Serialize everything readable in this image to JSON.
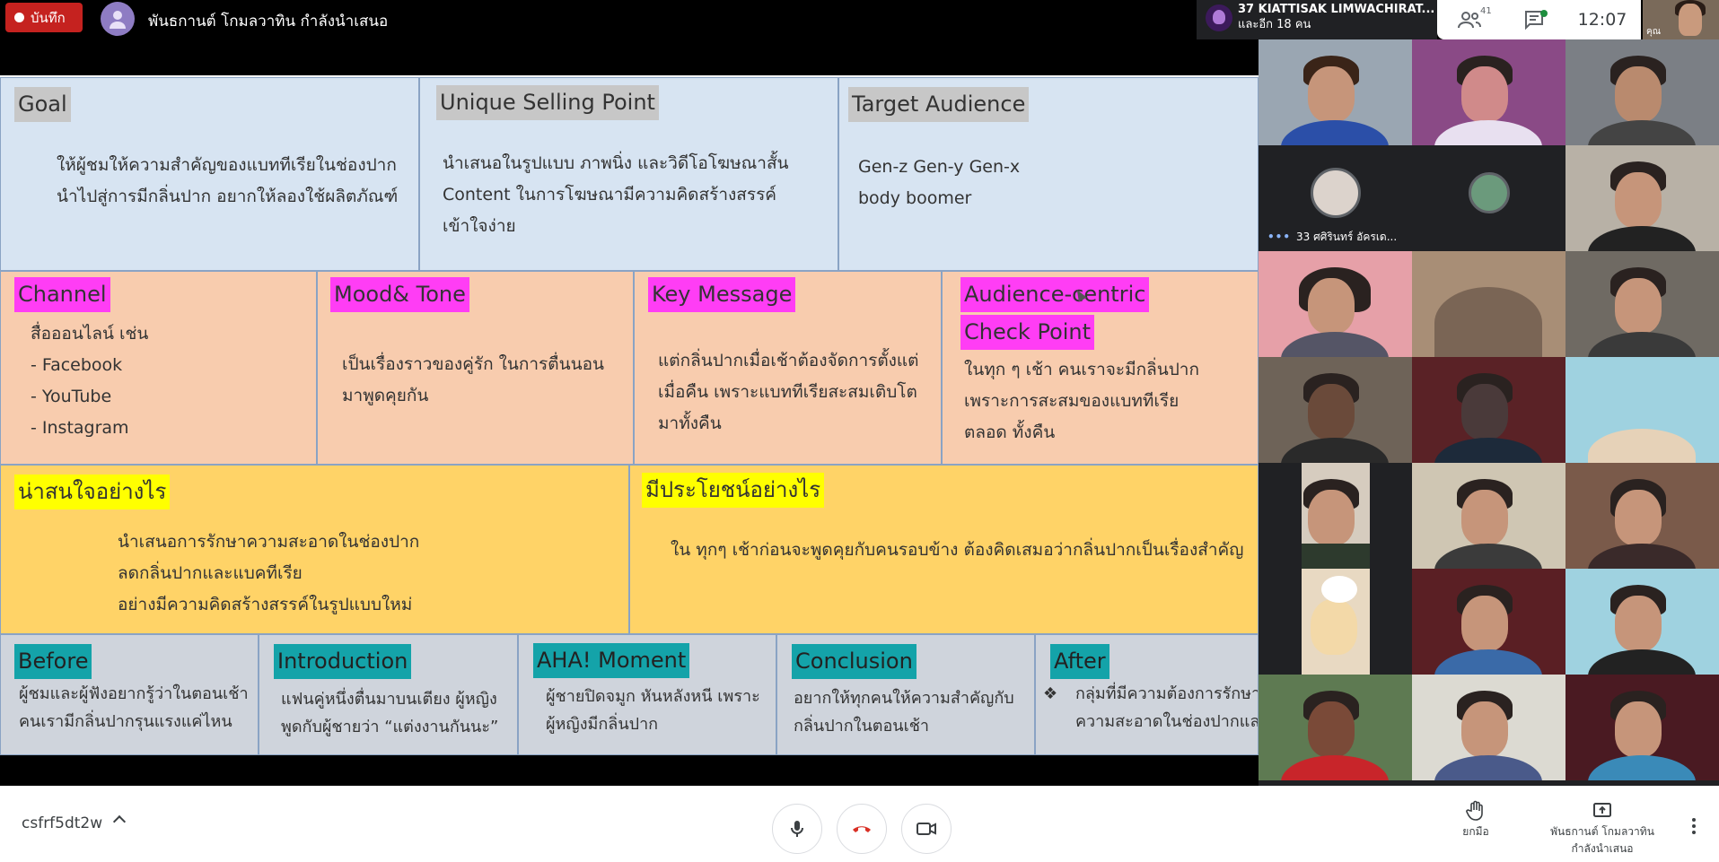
{
  "top_bar": {
    "record_label": "บันทึก",
    "presenter_title": "พันธกานต์ โกมลวาทิน กำลังนำเสนอ",
    "pinned_user_name": "37 KIATTISAK LIMWACHIRAT...",
    "pinned_user_sub": "และอีก 18 คน",
    "participant_count": "41",
    "clock": "12:07",
    "self_label": "คุณ"
  },
  "slide": {
    "goal": {
      "heading": "Goal",
      "lines": [
        "ให้ผู้ชมให้ความสำคัญของแบททีเรียในช่องปาก",
        "นำไปสู่การมีกลิ่นปาก อยากให้ลองใช้ผลิตภัณฑ์"
      ]
    },
    "usp": {
      "heading": "Unique Selling Point",
      "lines": [
        "นำเสนอในรูปแบบ ภาพนิ่ง และวิดีโอโฆษณาสั้น",
        "Content ในการโฆษณามีความคิดสร้างสรรค์",
        "เข้าใจง่าย"
      ]
    },
    "target": {
      "heading": "Target Audience",
      "lines": [
        "Gen-z Gen-y Gen-x",
        "body boomer"
      ]
    },
    "channel": {
      "heading": "Channel",
      "lines": [
        "สื่อออนไลน์ เช่น",
        "- Facebook",
        "- YouTube",
        "- Instagram"
      ]
    },
    "mood": {
      "heading": "Mood& Tone",
      "lines": [
        "เป็นเรื่องราวของคู่รัก ในการตื่นนอน",
        "มาพูดคุยกัน"
      ]
    },
    "key_message": {
      "heading": "Key Message",
      "lines": [
        "แต่กลิ่นปากเมื่อเช้าต้องจัดการตั้งแต่",
        "เมื่อคืน เพราะแบททีเรียสะสมเติบโต",
        "มาทั้งคืน"
      ]
    },
    "audience_centric": {
      "heading_1": "Audience-centric",
      "heading_2": "Check Point",
      "lines": [
        "ในทุก ๆ เช้า คนเราจะมีกลิ่นปาก",
        "เพราะการสะสมของแบททีเรีย",
        "ตลอด ทั้งคืน"
      ]
    },
    "interesting": {
      "heading": "น่าสนใจอย่างไร",
      "lines": [
        "นำเสนอการรักษาความสะอาดในช่องปาก",
        "ลดกลิ่นปากและแบคทีเรีย",
        "อย่างมีความคิดสร้างสรรค์ในรูปแบบใหม่"
      ]
    },
    "benefit": {
      "heading": "มีประโยชน์อย่างไร",
      "lines": [
        "ใน ทุกๆ เช้าก่อนจะพูดคุยกับคนรอบข้าง ต้องคิดเสมอว่ากลิ่นปากเป็นเรื่องสำคัญ"
      ]
    },
    "before": {
      "heading": "Before",
      "lines": [
        "ผู้ชมและผู้ฟังอยากรู้ว่าในตอนเช้า",
        "คนเรามีกลิ่นปากรุนแรงแค่ไหน"
      ]
    },
    "introduction": {
      "heading": "Introduction",
      "lines": [
        "แฟนคู่หนึ่งตื่นมาบนเตียง ผู้หญิง",
        "พูดกับผู้ชายว่า “แต่งงานกันนะ”"
      ]
    },
    "aha": {
      "heading": "AHA! Moment",
      "lines": [
        "ผู้ชายปิดจมูก หันหลังหนี เพราะ",
        "ผู้หญิงมีกลิ่นปาก"
      ]
    },
    "conclusion": {
      "heading": "Conclusion",
      "lines": [
        "อยากให้ทุกคนให้ความสำคัญกับ",
        "กลิ่นปากในตอนเช้า"
      ]
    },
    "after": {
      "heading": "After",
      "bullet": "❖",
      "lines": [
        "กลุ่มที่มีความต้องการรักษา",
        "ความสะอาดในช่องปากและ"
      ]
    }
  },
  "grid": {
    "avatar_tile_label": "33 ศศิรินทร์ อัครเด..."
  },
  "bottom_bar": {
    "meeting_code": "csfrf5dt2w",
    "raise_hand_label": "ยกมือ",
    "presenting_label_1": "พันธกานต์ โกมลวาทิน",
    "presenting_label_2": "กำลังนำเสนอ"
  }
}
